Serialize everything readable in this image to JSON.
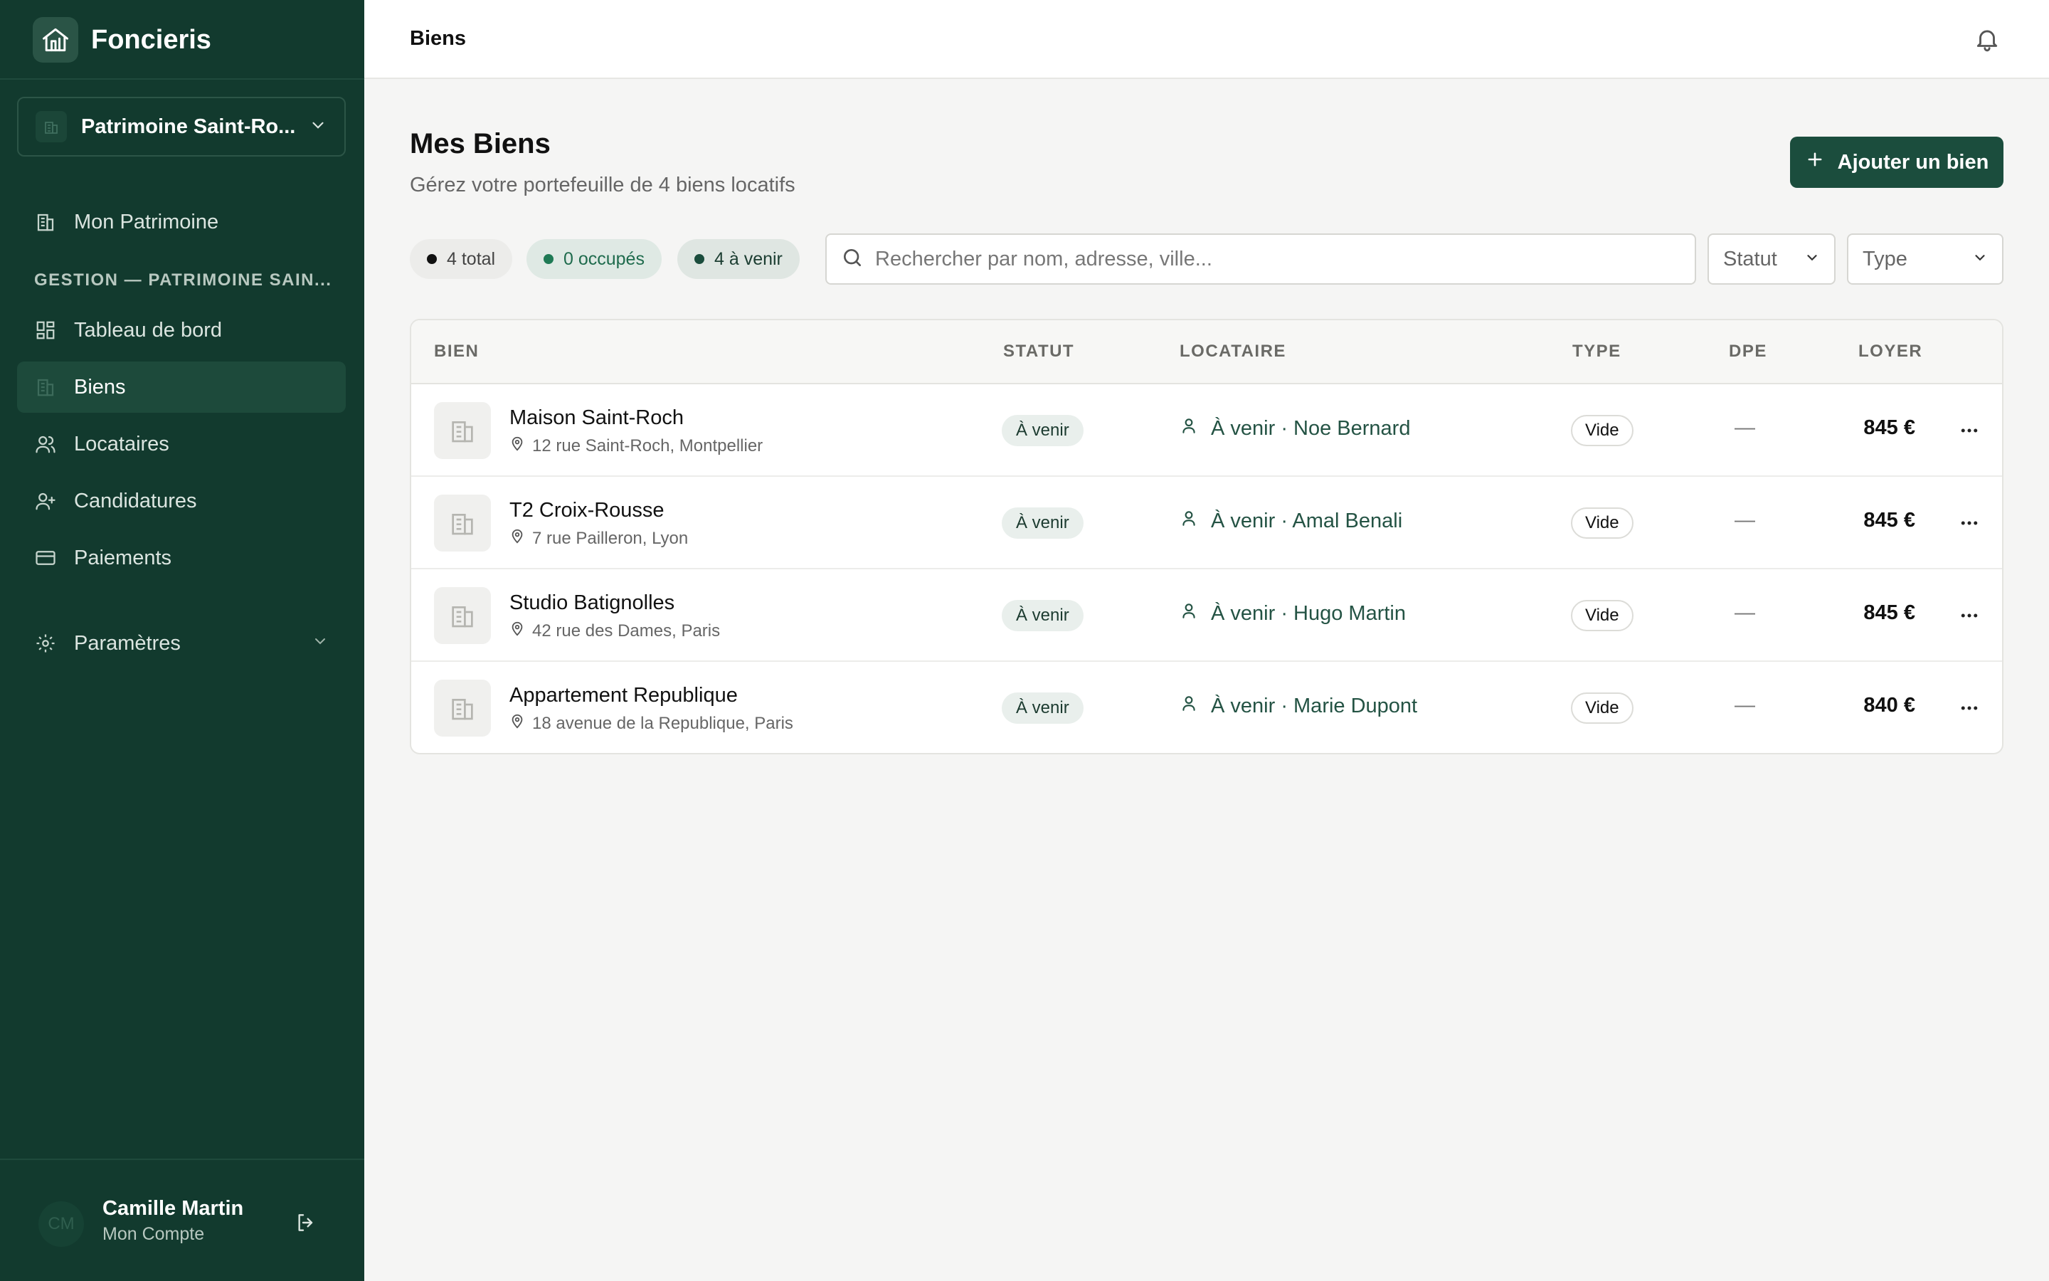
{
  "app": {
    "name": "Foncieris"
  },
  "sidebar": {
    "workspace": "Patrimoine Saint-Ro...",
    "items": [
      {
        "label": "Mon Patrimoine",
        "icon": "building-icon"
      },
      {
        "label": "Tableau de bord",
        "icon": "dashboard-icon"
      },
      {
        "label": "Biens",
        "icon": "building-icon",
        "active": true
      },
      {
        "label": "Locataires",
        "icon": "users-icon"
      },
      {
        "label": "Candidatures",
        "icon": "user-plus-icon"
      },
      {
        "label": "Paiements",
        "icon": "card-icon"
      },
      {
        "label": "Paramètres",
        "icon": "gear-icon"
      }
    ],
    "section_label": "GESTION — PATRIMOINE SAIN...",
    "user": {
      "initials": "CM",
      "name": "Camille Martin",
      "subtitle": "Mon Compte"
    }
  },
  "topbar": {
    "title": "Biens"
  },
  "page": {
    "title": "Mes Biens",
    "subtitle": "Gérez votre portefeuille de 4 biens locatifs",
    "add_button": "Ajouter un bien"
  },
  "filters": {
    "chips": [
      {
        "label": "4 total",
        "color": "#111111"
      },
      {
        "label": "0 occupés",
        "color": "#1f7a55"
      },
      {
        "label": "4 à venir",
        "color": "#1b4d3d"
      }
    ],
    "search_placeholder": "Rechercher par nom, adresse, ville...",
    "status_select": "Statut",
    "type_select": "Type"
  },
  "table": {
    "headers": [
      "BIEN",
      "STATUT",
      "LOCATAIRE",
      "TYPE",
      "DPE",
      "LOYER"
    ],
    "rows": [
      {
        "name": "Maison Saint-Roch",
        "address": "12 rue Saint-Roch, Montpellier",
        "status": "À venir",
        "tenant": "À venir · Noe Bernard",
        "type": "Vide",
        "dpe": "—",
        "rent": "845 €"
      },
      {
        "name": "T2 Croix-Rousse",
        "address": "7 rue Pailleron, Lyon",
        "status": "À venir",
        "tenant": "À venir · Amal Benali",
        "type": "Vide",
        "dpe": "—",
        "rent": "845 €"
      },
      {
        "name": "Studio Batignolles",
        "address": "42 rue des Dames, Paris",
        "status": "À venir",
        "tenant": "À venir · Hugo Martin",
        "type": "Vide",
        "dpe": "—",
        "rent": "845 €"
      },
      {
        "name": "Appartement Republique",
        "address": "18 avenue de la Republique, Paris",
        "status": "À venir",
        "tenant": "À venir · Marie Dupont",
        "type": "Vide",
        "dpe": "—",
        "rent": "840 €"
      }
    ]
  },
  "colors": {
    "sidebar_bg": "#123a2e",
    "accent": "#1b4d3d",
    "page_bg": "#f5f5f4"
  }
}
